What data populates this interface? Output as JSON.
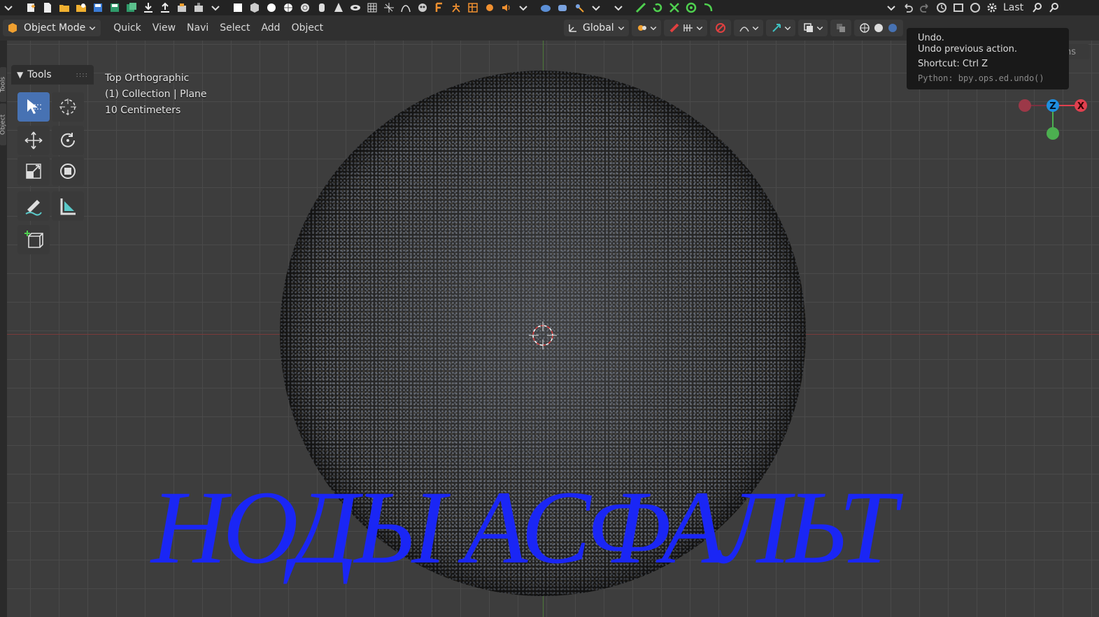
{
  "header": {
    "mode_label": "Object Mode",
    "menus": [
      "Quick",
      "View",
      "Navi",
      "Select",
      "Add",
      "Object"
    ],
    "orientation_label": "Global",
    "last_label": "Last"
  },
  "tools": {
    "panel_title": "Tools",
    "items": [
      "select-box",
      "cursor",
      "move",
      "rotate",
      "scale",
      "transform",
      "annotate",
      "measure",
      "add-cube"
    ],
    "active": "select-box"
  },
  "side_tabs": [
    "Tools",
    "Object"
  ],
  "viewport": {
    "view_name": "Top Orthographic",
    "collection_info": "(1) Collection | Plane",
    "scale_info": "10 Centimeters"
  },
  "tooltip": {
    "title": "Undo.",
    "description": "Undo previous action.",
    "shortcut": "Shortcut: Ctrl Z",
    "python": "Python: bpy.ops.ed.undo()"
  },
  "options_label": "Options",
  "gizmo": {
    "z_label": "Z",
    "x_label": "X"
  },
  "overlay_title": "НОДЫ АСФАЛЬТ",
  "colors": {
    "accent": "#4772b3",
    "title_blue": "#1a26f5",
    "axis_x": "#e0404f",
    "axis_y": "#4caf50",
    "axis_z": "#1f8fe0"
  }
}
